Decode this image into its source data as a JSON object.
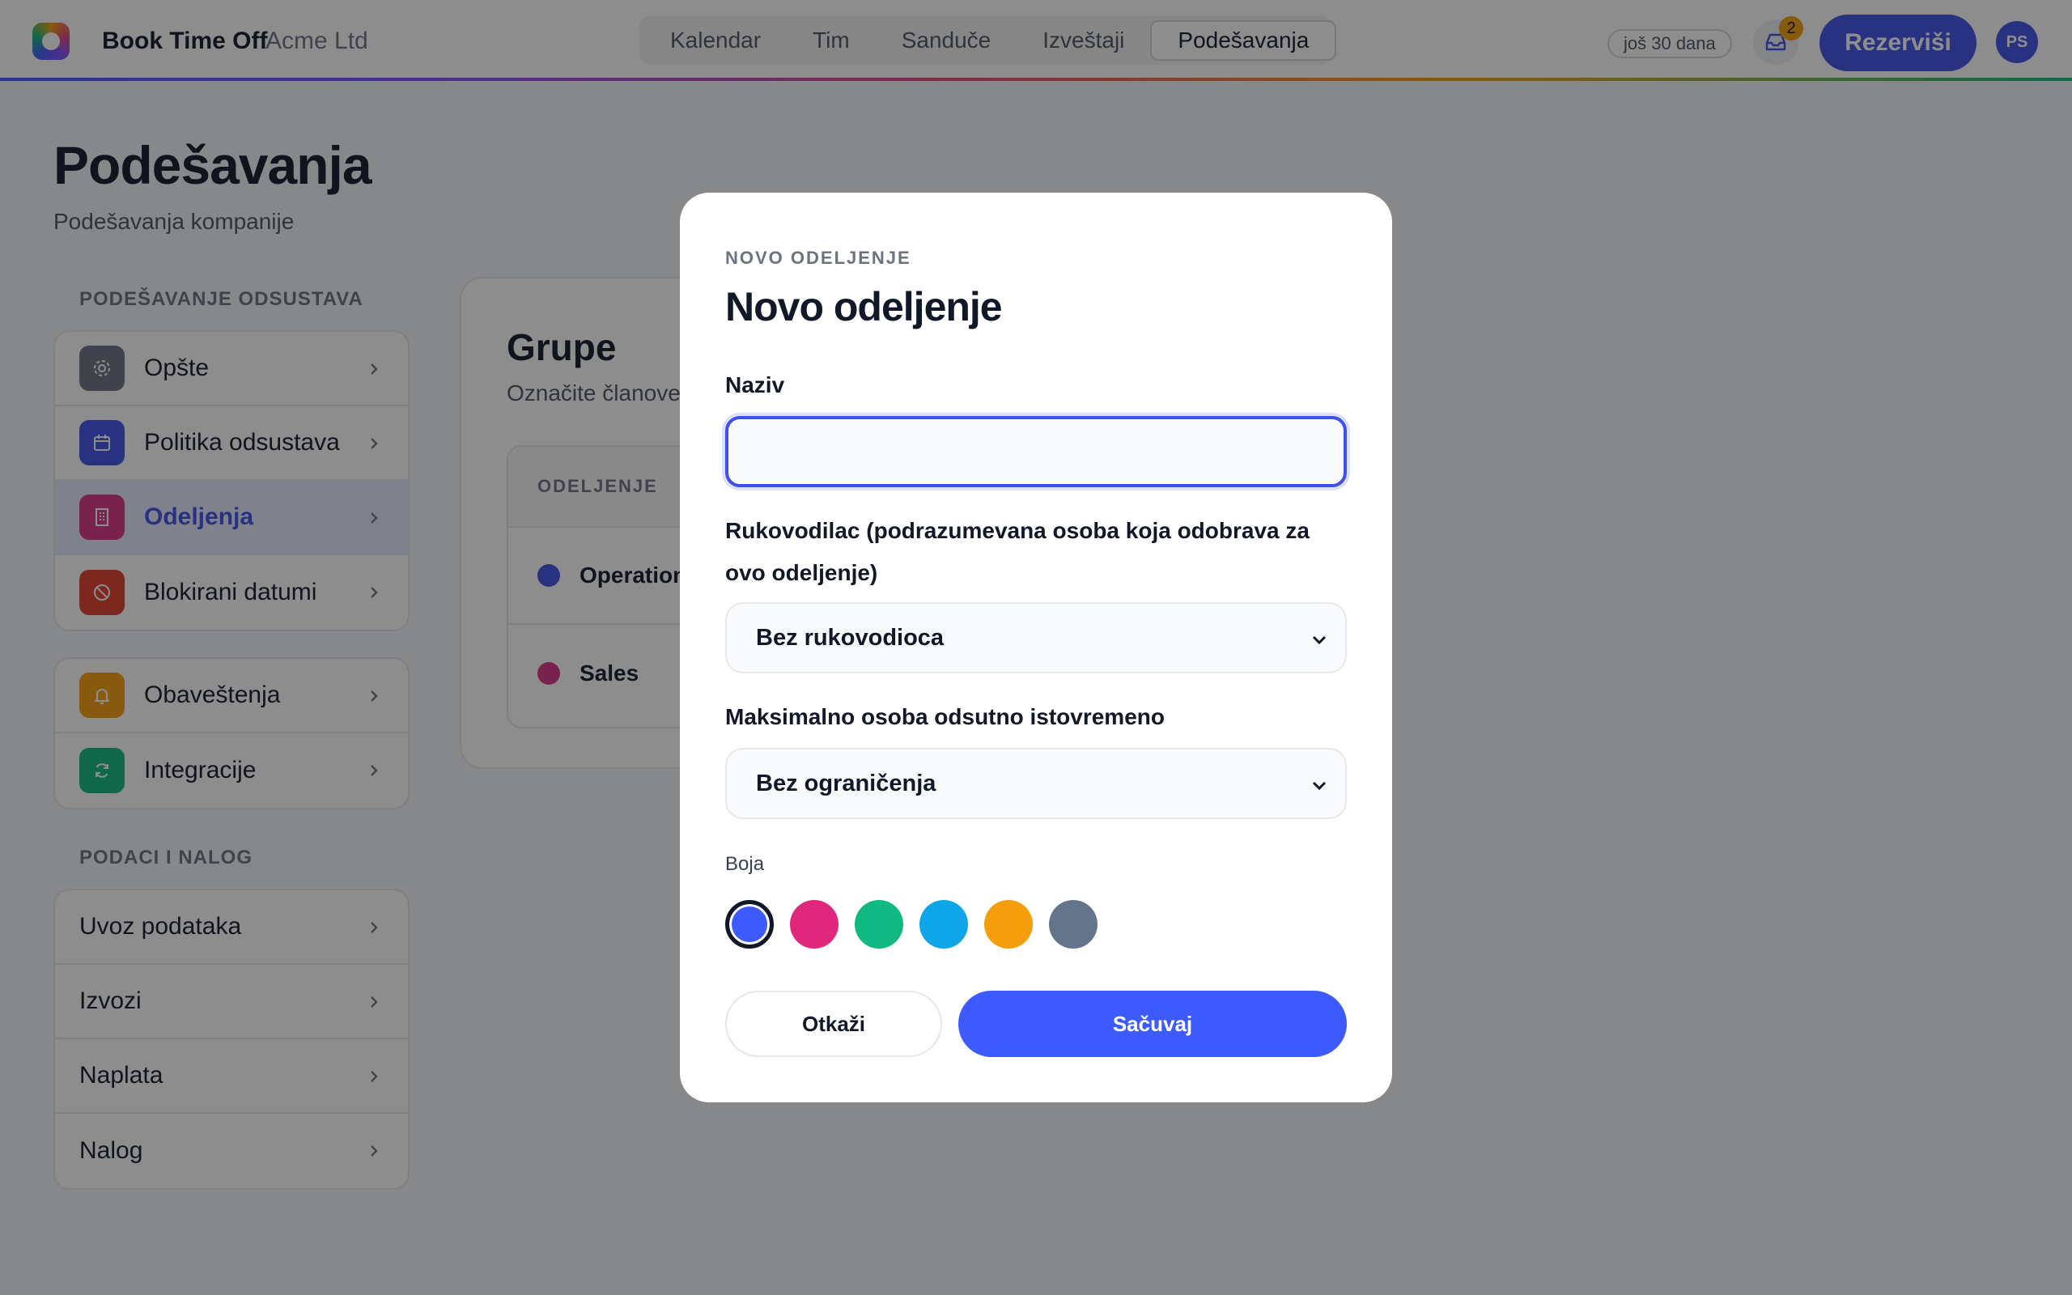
{
  "header": {
    "brand": "Book Time Off",
    "company": "Acme Ltd",
    "tabs": [
      "Kalendar",
      "Tim",
      "Sanduče",
      "Izveštaji",
      "Podešavanja"
    ],
    "active_tab": "Podešavanja",
    "trial": "još 30 dana",
    "inbox_count": "2",
    "book_label": "Rezerviši",
    "avatar_initials": "PS"
  },
  "page": {
    "title": "Podešavanja",
    "subtitle": "Podešavanja kompanije"
  },
  "sidebar": {
    "section1_label": "PODEŠAVANJE ODSUSTAVA",
    "group1": [
      {
        "label": "Opšte",
        "icon": "gear-icon",
        "color": "#6b7280"
      },
      {
        "label": "Politika odsustava",
        "icon": "calendar-icon",
        "color": "#3f51e6"
      },
      {
        "label": "Odeljenja",
        "icon": "building-icon",
        "color": "#d63384",
        "active": true
      },
      {
        "label": "Blokirani datumi",
        "icon": "block-icon",
        "color": "#e03e2d"
      }
    ],
    "group2": [
      {
        "label": "Obaveštenja",
        "icon": "bell-icon",
        "color": "#f59e0b"
      },
      {
        "label": "Integracije",
        "icon": "refresh-icon",
        "color": "#10b981"
      }
    ],
    "section2_label": "PODACI I NALOG",
    "group3": [
      {
        "label": "Uvoz podataka"
      },
      {
        "label": "Izvozi"
      },
      {
        "label": "Naplata"
      },
      {
        "label": "Nalog"
      }
    ]
  },
  "groups_card": {
    "title": "Grupe",
    "subtitle": "Označite članove",
    "column_header": "ODELJENJE",
    "rows": [
      {
        "name": "Operation",
        "color": "#3f51e6"
      },
      {
        "name": "Sales",
        "color": "#d63384"
      }
    ]
  },
  "modal": {
    "eyebrow": "NOVO ODELJENJE",
    "title": "Novo odeljenje",
    "name_label": "Naziv",
    "name_value": "",
    "manager_label": "Rukovodilac (podrazumevana osoba koja odobrava za ovo odeljenje)",
    "manager_value": "Bez rukovodioca",
    "max_label": "Maksimalno osoba odsutno istovremeno",
    "max_value": "Bez ograničenja",
    "color_label": "Boja",
    "colors": [
      "#3d5afe",
      "#e0277b",
      "#10b981",
      "#0ea5e9",
      "#f59e0b",
      "#64748b"
    ],
    "selected_color": "#3d5afe",
    "cancel_label": "Otkaži",
    "save_label": "Sačuvaj"
  }
}
